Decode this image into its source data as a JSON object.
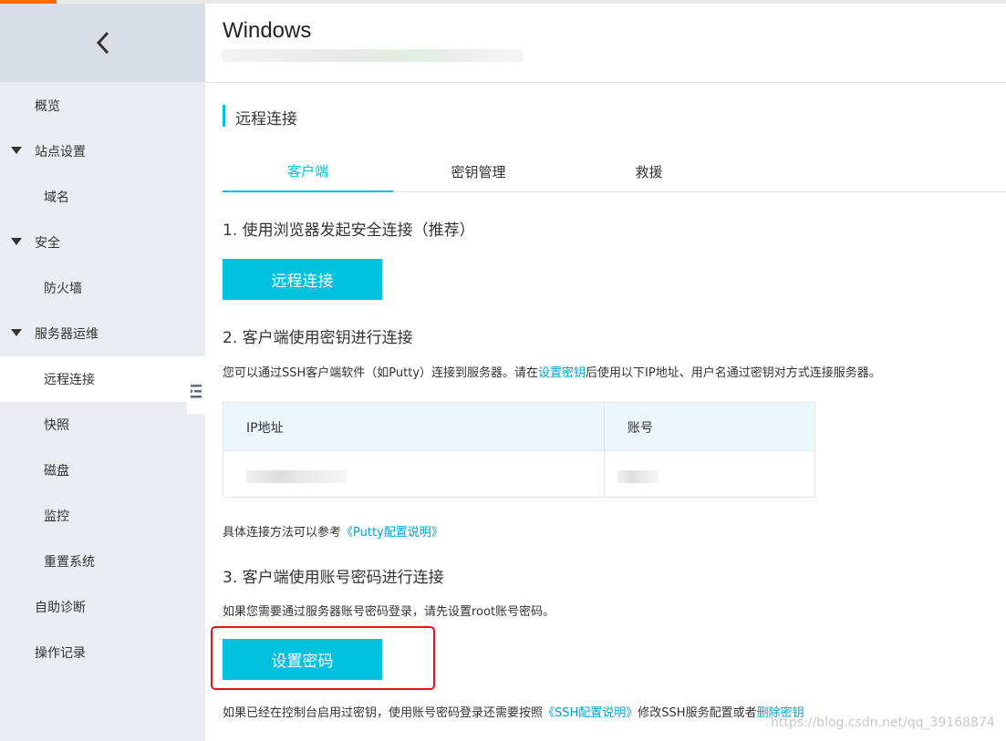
{
  "sidebar": {
    "items": [
      {
        "label": "概览"
      },
      {
        "label": "站点设置"
      },
      {
        "label": "域名"
      },
      {
        "label": "安全"
      },
      {
        "label": "防火墙"
      },
      {
        "label": "服务器运维"
      },
      {
        "label": "远程连接"
      },
      {
        "label": "快照"
      },
      {
        "label": "磁盘"
      },
      {
        "label": "监控"
      },
      {
        "label": "重置系统"
      },
      {
        "label": "自助诊断"
      },
      {
        "label": "操作记录"
      }
    ]
  },
  "header": {
    "title": "Windows"
  },
  "section": {
    "title": "远程连接"
  },
  "tabs": [
    {
      "label": "客户端",
      "active": true
    },
    {
      "label": "密钥管理",
      "active": false
    },
    {
      "label": "救援",
      "active": false
    }
  ],
  "step1": {
    "heading": "1. 使用浏览器发起安全连接（推荐）",
    "button": "远程连接"
  },
  "step2": {
    "heading": "2. 客户端使用密钥进行连接",
    "desc_before": "您可以通过SSH客户端软件（如Putty）连接到服务器。请在",
    "desc_link": "设置密钥",
    "desc_after": "后使用以下IP地址、用户名通过密钥对方式连接服务器。",
    "table": {
      "headers": [
        "IP地址",
        "账号"
      ]
    },
    "ref_before": "具体连接方法可以参考",
    "ref_link": "《Putty配置说明》"
  },
  "step3": {
    "heading": "3. 客户端使用账号密码进行连接",
    "desc": "如果您需要通过服务器账号密码登录，请先设置root账号密码。",
    "button": "设置密码",
    "note_before": "如果已经在控制台启用过密钥，使用账号密码登录还需要按照",
    "note_link1": "《SSH配置说明》",
    "note_middle": "修改SSH服务配置或者",
    "note_link2": "删除密钥"
  },
  "watermark": "https://blog.csdn.net/qq_39168874",
  "colors": {
    "accent": "#00c1de",
    "link": "#00a2ca",
    "highlight": "#e8111a",
    "brand": "#ff6a00"
  }
}
